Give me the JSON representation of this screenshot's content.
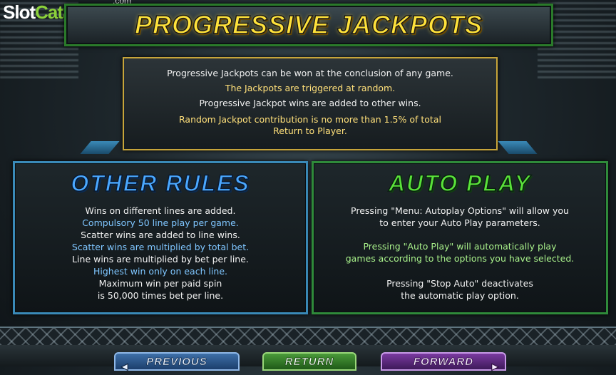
{
  "logo": {
    "slot": "Slot",
    "catalog": "Catalog",
    "domain": ".com"
  },
  "title": "PROGRESSIVE JACKPOTS",
  "progressive_info": [
    "Progressive Jackpots can be won at the conclusion of any game.",
    "The Jackpots are triggered at random.",
    "Progressive Jackpot wins are added to other wins.",
    "Random Jackpot contribution is no more than 1.5% of total",
    "Return to Player."
  ],
  "other_rules": {
    "title": "OTHER RULES",
    "lines": [
      "Wins on different lines are added.",
      "Compulsory 50 line play per game.",
      "Scatter wins are added to line wins.",
      "Scatter wins are multiplied by total bet.",
      "Line wins are multiplied by bet per line.",
      "Highest win only on each line.",
      "Maximum win per paid spin",
      "is 50,000 times bet per line."
    ]
  },
  "auto_play": {
    "title": "AUTO PLAY",
    "lines": [
      "Pressing \"Menu: Autoplay Options\" will allow you",
      "to enter your Auto Play parameters.",
      "Pressing \"Auto Play\" will automatically play",
      "games according to the options you have selected.",
      "Pressing \"Stop Auto\" deactivates",
      "the automatic play option."
    ]
  },
  "nav": {
    "previous": "PREVIOUS",
    "return": "RETURN",
    "forward": "FORWARD"
  },
  "colors": {
    "title_yellow": "#ffe23a",
    "other_rules_blue": "#4aa8ff",
    "auto_play_green": "#5ae23a",
    "text_yellow": "#ffe07a",
    "text_blue": "#7fc6ff",
    "text_green": "#a8f08a"
  },
  "icons": {
    "previous": "arrow-left-icon",
    "forward": "arrow-right-icon"
  }
}
